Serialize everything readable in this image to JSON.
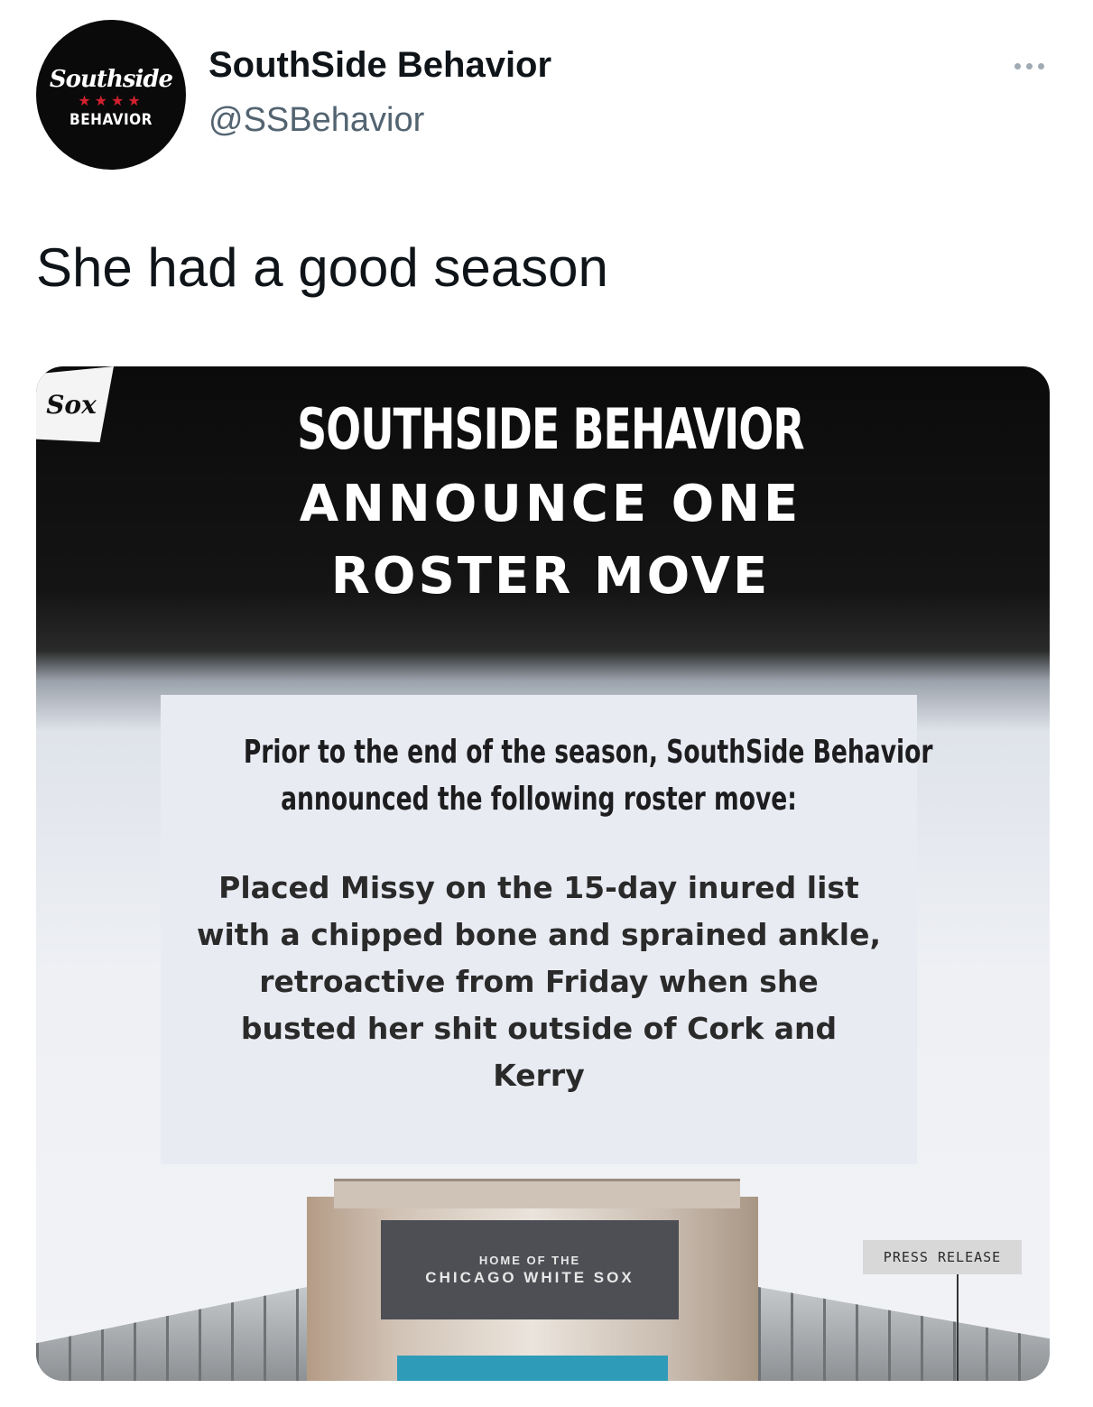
{
  "tweet": {
    "avatar": {
      "logo_top": "Southside",
      "logo_stars": "★★★★",
      "logo_bottom": "BEHAVIOR"
    },
    "display_name": "SouthSide Behavior",
    "handle": "@SSBehavior",
    "text": "She had a good season"
  },
  "media": {
    "corner_logo": "Sox",
    "headline": {
      "line1": "SOUTHSIDE BEHAVIOR",
      "line2": "ANNOUNCE ONE",
      "line3": "ROSTER MOVE"
    },
    "intro": {
      "line1": "Prior to the end of the season, SouthSide Behavior",
      "line2": "announced the following roster move:"
    },
    "body": "Placed Missy on the 15-day inured list with a chipped bone and sprained ankle, retroactive from Friday when she busted her shit outside of Cork and Kerry",
    "stadium_sign": {
      "line1": "HOME OF THE",
      "line2": "CHICAGO WHITE SOX"
    },
    "press_label": "PRESS RELEASE"
  },
  "icons": {
    "more": "more-horizontal-icon"
  },
  "colors": {
    "name_text": "#0f1419",
    "handle_text": "#536471",
    "star_red": "#d2202f"
  }
}
